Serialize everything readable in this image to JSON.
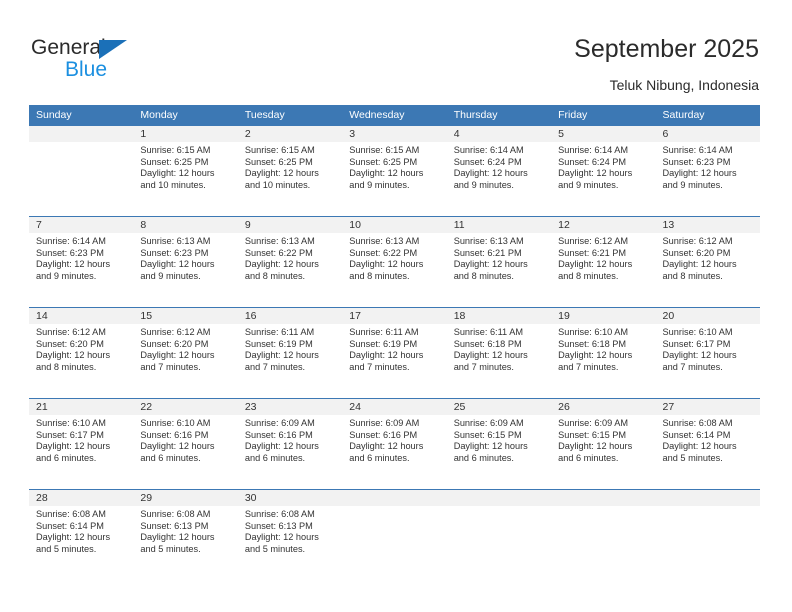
{
  "brand": {
    "name_part1": "General",
    "name_part2": "Blue"
  },
  "header": {
    "title": "September 2025",
    "subtitle": "Teluk Nibung, Indonesia"
  },
  "colors": {
    "header_blue": "#3c78b4",
    "logo_blue": "#1b8fe0",
    "daynum_band": "#f2f2f2"
  },
  "calendar": {
    "weekday_headers": [
      "Sunday",
      "Monday",
      "Tuesday",
      "Wednesday",
      "Thursday",
      "Friday",
      "Saturday"
    ],
    "weeks": [
      [
        {
          "day": "",
          "sunrise": "",
          "sunset": "",
          "daylight": "",
          "daylight2": ""
        },
        {
          "day": "1",
          "sunrise": "Sunrise: 6:15 AM",
          "sunset": "Sunset: 6:25 PM",
          "daylight": "Daylight: 12 hours",
          "daylight2": "and 10 minutes."
        },
        {
          "day": "2",
          "sunrise": "Sunrise: 6:15 AM",
          "sunset": "Sunset: 6:25 PM",
          "daylight": "Daylight: 12 hours",
          "daylight2": "and 10 minutes."
        },
        {
          "day": "3",
          "sunrise": "Sunrise: 6:15 AM",
          "sunset": "Sunset: 6:25 PM",
          "daylight": "Daylight: 12 hours",
          "daylight2": "and 9 minutes."
        },
        {
          "day": "4",
          "sunrise": "Sunrise: 6:14 AM",
          "sunset": "Sunset: 6:24 PM",
          "daylight": "Daylight: 12 hours",
          "daylight2": "and 9 minutes."
        },
        {
          "day": "5",
          "sunrise": "Sunrise: 6:14 AM",
          "sunset": "Sunset: 6:24 PM",
          "daylight": "Daylight: 12 hours",
          "daylight2": "and 9 minutes."
        },
        {
          "day": "6",
          "sunrise": "Sunrise: 6:14 AM",
          "sunset": "Sunset: 6:23 PM",
          "daylight": "Daylight: 12 hours",
          "daylight2": "and 9 minutes."
        }
      ],
      [
        {
          "day": "7",
          "sunrise": "Sunrise: 6:14 AM",
          "sunset": "Sunset: 6:23 PM",
          "daylight": "Daylight: 12 hours",
          "daylight2": "and 9 minutes."
        },
        {
          "day": "8",
          "sunrise": "Sunrise: 6:13 AM",
          "sunset": "Sunset: 6:23 PM",
          "daylight": "Daylight: 12 hours",
          "daylight2": "and 9 minutes."
        },
        {
          "day": "9",
          "sunrise": "Sunrise: 6:13 AM",
          "sunset": "Sunset: 6:22 PM",
          "daylight": "Daylight: 12 hours",
          "daylight2": "and 8 minutes."
        },
        {
          "day": "10",
          "sunrise": "Sunrise: 6:13 AM",
          "sunset": "Sunset: 6:22 PM",
          "daylight": "Daylight: 12 hours",
          "daylight2": "and 8 minutes."
        },
        {
          "day": "11",
          "sunrise": "Sunrise: 6:13 AM",
          "sunset": "Sunset: 6:21 PM",
          "daylight": "Daylight: 12 hours",
          "daylight2": "and 8 minutes."
        },
        {
          "day": "12",
          "sunrise": "Sunrise: 6:12 AM",
          "sunset": "Sunset: 6:21 PM",
          "daylight": "Daylight: 12 hours",
          "daylight2": "and 8 minutes."
        },
        {
          "day": "13",
          "sunrise": "Sunrise: 6:12 AM",
          "sunset": "Sunset: 6:20 PM",
          "daylight": "Daylight: 12 hours",
          "daylight2": "and 8 minutes."
        }
      ],
      [
        {
          "day": "14",
          "sunrise": "Sunrise: 6:12 AM",
          "sunset": "Sunset: 6:20 PM",
          "daylight": "Daylight: 12 hours",
          "daylight2": "and 8 minutes."
        },
        {
          "day": "15",
          "sunrise": "Sunrise: 6:12 AM",
          "sunset": "Sunset: 6:20 PM",
          "daylight": "Daylight: 12 hours",
          "daylight2": "and 7 minutes."
        },
        {
          "day": "16",
          "sunrise": "Sunrise: 6:11 AM",
          "sunset": "Sunset: 6:19 PM",
          "daylight": "Daylight: 12 hours",
          "daylight2": "and 7 minutes."
        },
        {
          "day": "17",
          "sunrise": "Sunrise: 6:11 AM",
          "sunset": "Sunset: 6:19 PM",
          "daylight": "Daylight: 12 hours",
          "daylight2": "and 7 minutes."
        },
        {
          "day": "18",
          "sunrise": "Sunrise: 6:11 AM",
          "sunset": "Sunset: 6:18 PM",
          "daylight": "Daylight: 12 hours",
          "daylight2": "and 7 minutes."
        },
        {
          "day": "19",
          "sunrise": "Sunrise: 6:10 AM",
          "sunset": "Sunset: 6:18 PM",
          "daylight": "Daylight: 12 hours",
          "daylight2": "and 7 minutes."
        },
        {
          "day": "20",
          "sunrise": "Sunrise: 6:10 AM",
          "sunset": "Sunset: 6:17 PM",
          "daylight": "Daylight: 12 hours",
          "daylight2": "and 7 minutes."
        }
      ],
      [
        {
          "day": "21",
          "sunrise": "Sunrise: 6:10 AM",
          "sunset": "Sunset: 6:17 PM",
          "daylight": "Daylight: 12 hours",
          "daylight2": "and 6 minutes."
        },
        {
          "day": "22",
          "sunrise": "Sunrise: 6:10 AM",
          "sunset": "Sunset: 6:16 PM",
          "daylight": "Daylight: 12 hours",
          "daylight2": "and 6 minutes."
        },
        {
          "day": "23",
          "sunrise": "Sunrise: 6:09 AM",
          "sunset": "Sunset: 6:16 PM",
          "daylight": "Daylight: 12 hours",
          "daylight2": "and 6 minutes."
        },
        {
          "day": "24",
          "sunrise": "Sunrise: 6:09 AM",
          "sunset": "Sunset: 6:16 PM",
          "daylight": "Daylight: 12 hours",
          "daylight2": "and 6 minutes."
        },
        {
          "day": "25",
          "sunrise": "Sunrise: 6:09 AM",
          "sunset": "Sunset: 6:15 PM",
          "daylight": "Daylight: 12 hours",
          "daylight2": "and 6 minutes."
        },
        {
          "day": "26",
          "sunrise": "Sunrise: 6:09 AM",
          "sunset": "Sunset: 6:15 PM",
          "daylight": "Daylight: 12 hours",
          "daylight2": "and 6 minutes."
        },
        {
          "day": "27",
          "sunrise": "Sunrise: 6:08 AM",
          "sunset": "Sunset: 6:14 PM",
          "daylight": "Daylight: 12 hours",
          "daylight2": "and 5 minutes."
        }
      ],
      [
        {
          "day": "28",
          "sunrise": "Sunrise: 6:08 AM",
          "sunset": "Sunset: 6:14 PM",
          "daylight": "Daylight: 12 hours",
          "daylight2": "and 5 minutes."
        },
        {
          "day": "29",
          "sunrise": "Sunrise: 6:08 AM",
          "sunset": "Sunset: 6:13 PM",
          "daylight": "Daylight: 12 hours",
          "daylight2": "and 5 minutes."
        },
        {
          "day": "30",
          "sunrise": "Sunrise: 6:08 AM",
          "sunset": "Sunset: 6:13 PM",
          "daylight": "Daylight: 12 hours",
          "daylight2": "and 5 minutes."
        },
        {
          "day": "",
          "sunrise": "",
          "sunset": "",
          "daylight": "",
          "daylight2": ""
        },
        {
          "day": "",
          "sunrise": "",
          "sunset": "",
          "daylight": "",
          "daylight2": ""
        },
        {
          "day": "",
          "sunrise": "",
          "sunset": "",
          "daylight": "",
          "daylight2": ""
        },
        {
          "day": "",
          "sunrise": "",
          "sunset": "",
          "daylight": "",
          "daylight2": ""
        }
      ]
    ]
  }
}
